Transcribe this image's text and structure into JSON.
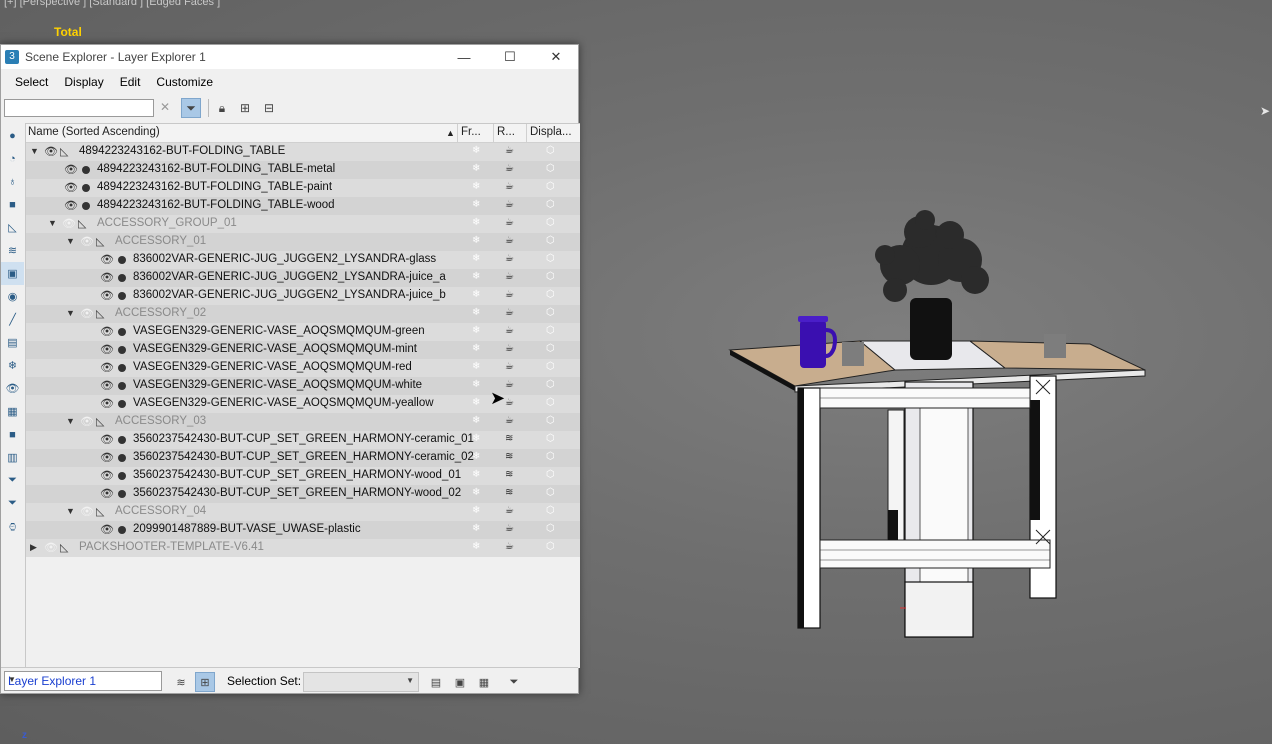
{
  "viewport": {
    "label": "[+] [Perspective ] [Standard ] [Edged Faces ]",
    "total": "Total",
    "z_axis": "z"
  },
  "window": {
    "title": "Scene Explorer - Layer Explorer 1",
    "minimize": "—",
    "maximize": "☐",
    "close": "✕"
  },
  "menu": [
    "Select",
    "Display",
    "Edit",
    "Customize"
  ],
  "search": {
    "value": "",
    "placeholder": ""
  },
  "columns": {
    "name": "Name (Sorted Ascending)",
    "freeze": "Fr...",
    "render": "R...",
    "display": "Displa..."
  },
  "rows": [
    {
      "name": "4894223243162-BUT-FOLDING_TABLE",
      "level": 0,
      "kind": "layer",
      "expanded": true,
      "c2": "teapot"
    },
    {
      "name": "4894223243162-BUT-FOLDING_TABLE-metal",
      "level": 1,
      "kind": "object",
      "c2": "teapot"
    },
    {
      "name": "4894223243162-BUT-FOLDING_TABLE-paint",
      "level": 1,
      "kind": "object",
      "c2": "teapot"
    },
    {
      "name": "4894223243162-BUT-FOLDING_TABLE-wood",
      "level": 1,
      "kind": "object",
      "c2": "teapot"
    },
    {
      "name": "ACCESSORY_GROUP_01",
      "level": 1,
      "kind": "group",
      "expanded": true,
      "c2": "teapot"
    },
    {
      "name": "ACCESSORY_01",
      "level": 2,
      "kind": "layer-grey",
      "expanded": true,
      "c2": "teapot"
    },
    {
      "name": "836002VAR-GENERIC-JUG_JUGGEN2_LYSANDRA-glass",
      "level": 3,
      "kind": "object",
      "c2": "teapot"
    },
    {
      "name": "836002VAR-GENERIC-JUG_JUGGEN2_LYSANDRA-juice_a",
      "level": 3,
      "kind": "object",
      "c2": "teapot"
    },
    {
      "name": "836002VAR-GENERIC-JUG_JUGGEN2_LYSANDRA-juice_b",
      "level": 3,
      "kind": "object",
      "c2": "teapot"
    },
    {
      "name": "ACCESSORY_02",
      "level": 2,
      "kind": "layer-grey",
      "expanded": true,
      "c2": "teapot"
    },
    {
      "name": "VASEGEN329-GENERIC-VASE_AOQSMQMQUM-green",
      "level": 3,
      "kind": "object",
      "c2": "teapot"
    },
    {
      "name": "VASEGEN329-GENERIC-VASE_AOQSMQMQUM-mint",
      "level": 3,
      "kind": "object",
      "c2": "teapot"
    },
    {
      "name": "VASEGEN329-GENERIC-VASE_AOQSMQMQUM-red",
      "level": 3,
      "kind": "object",
      "c2": "teapot"
    },
    {
      "name": "VASEGEN329-GENERIC-VASE_AOQSMQMQUM-white",
      "level": 3,
      "kind": "object",
      "c2": "teapot"
    },
    {
      "name": "VASEGEN329-GENERIC-VASE_AOQSMQMQUM-yeallow",
      "level": 3,
      "kind": "object",
      "c2": "teapot"
    },
    {
      "name": "ACCESSORY_03",
      "level": 2,
      "kind": "layer-grey",
      "expanded": true,
      "c2": "teapot"
    },
    {
      "name": "3560237542430-BUT-CUP_SET_GREEN_HARMONY-ceramic_01",
      "level": 3,
      "kind": "object",
      "c2": "stack"
    },
    {
      "name": "3560237542430-BUT-CUP_SET_GREEN_HARMONY-ceramic_02",
      "level": 3,
      "kind": "object",
      "c2": "stack"
    },
    {
      "name": "3560237542430-BUT-CUP_SET_GREEN_HARMONY-wood_01",
      "level": 3,
      "kind": "object",
      "c2": "stack"
    },
    {
      "name": "3560237542430-BUT-CUP_SET_GREEN_HARMONY-wood_02",
      "level": 3,
      "kind": "object",
      "c2": "stack"
    },
    {
      "name": "ACCESSORY_04",
      "level": 2,
      "kind": "layer-grey",
      "expanded": true,
      "c2": "teapot"
    },
    {
      "name": "2099901487889-BUT-VASE_UWASE-plastic",
      "level": 3,
      "kind": "object",
      "c2": "teapot"
    },
    {
      "name": "PACKSHOOTER-TEMPLATE-V6.41",
      "level": 0,
      "kind": "layer-grey",
      "expanded": false,
      "c2": "teapot"
    }
  ],
  "bottom": {
    "explorer_name": "Layer Explorer 1",
    "selection_set_label": "Selection Set:",
    "selection_set_value": ""
  }
}
